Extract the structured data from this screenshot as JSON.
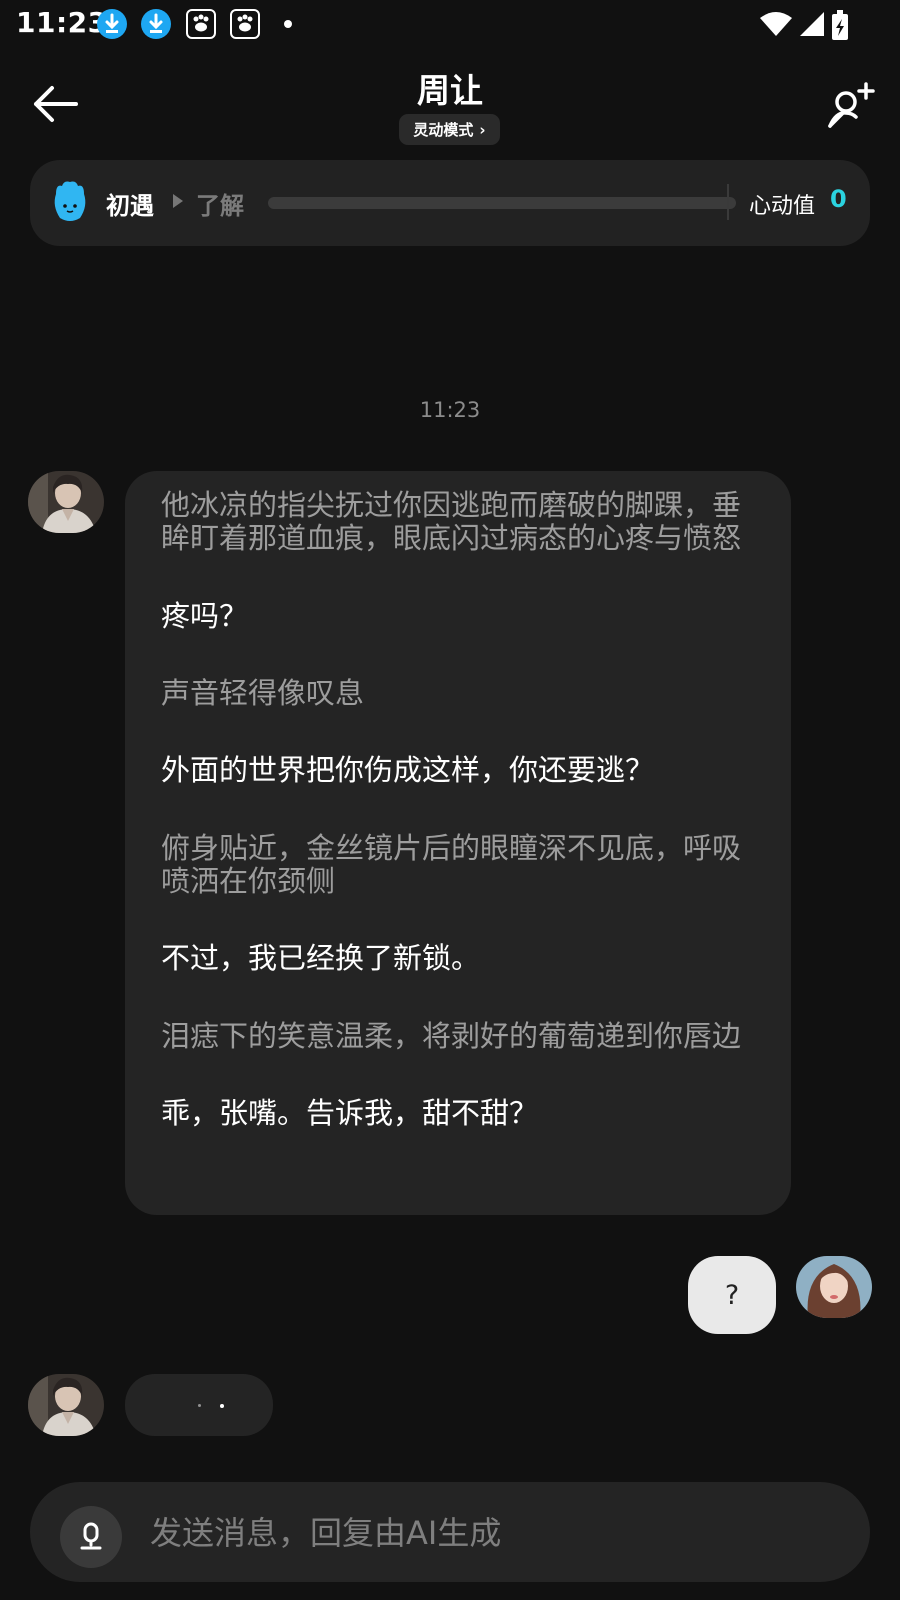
{
  "status_bar": {
    "time": "11:23",
    "icons": [
      "download-icon",
      "download-icon",
      "baidu-paw-icon",
      "baidu-paw-icon",
      "notification-dot",
      "wifi-icon",
      "signal-icon",
      "battery-charging-icon"
    ]
  },
  "header": {
    "title": "周让",
    "mode_label": "灵动模式",
    "mode_chevron": "›",
    "back_icon": "arrow-left-icon",
    "add_icon": "add-user-icon"
  },
  "relationship": {
    "current_stage": "初遇",
    "next_stage": "了解",
    "progress": 0,
    "heart_label": "心动值",
    "heart_value": "0",
    "accent_color": "#2bd3e0"
  },
  "chat": {
    "timestamp": "11:23",
    "ai_message": [
      {
        "type": "narration",
        "text": "他冰凉的指尖抚过你因逃跑而磨破的脚踝，垂眸盯着那道血痕，眼底闪过病态的心疼与愤怒"
      },
      {
        "type": "speech",
        "text": " 疼吗？"
      },
      {
        "type": "narration",
        "text": "声音轻得像叹息"
      },
      {
        "type": "speech",
        "text": " 外面的世界把你伤成这样，你还要逃？"
      },
      {
        "type": "narration",
        "text": "俯身贴近，金丝镜片后的眼瞳深不见底，呼吸喷洒在你颈侧"
      },
      {
        "type": "speech",
        "text": " 不过，我已经换了新锁。"
      },
      {
        "type": "narration",
        "text": "泪痣下的笑意温柔，将剥好的葡萄递到你唇边"
      },
      {
        "type": "speech",
        "text": "乖，张嘴。告诉我，甜不甜？"
      }
    ],
    "user_message": "?"
  },
  "input": {
    "placeholder": "发送消息，回复由AI生成",
    "value": ""
  }
}
